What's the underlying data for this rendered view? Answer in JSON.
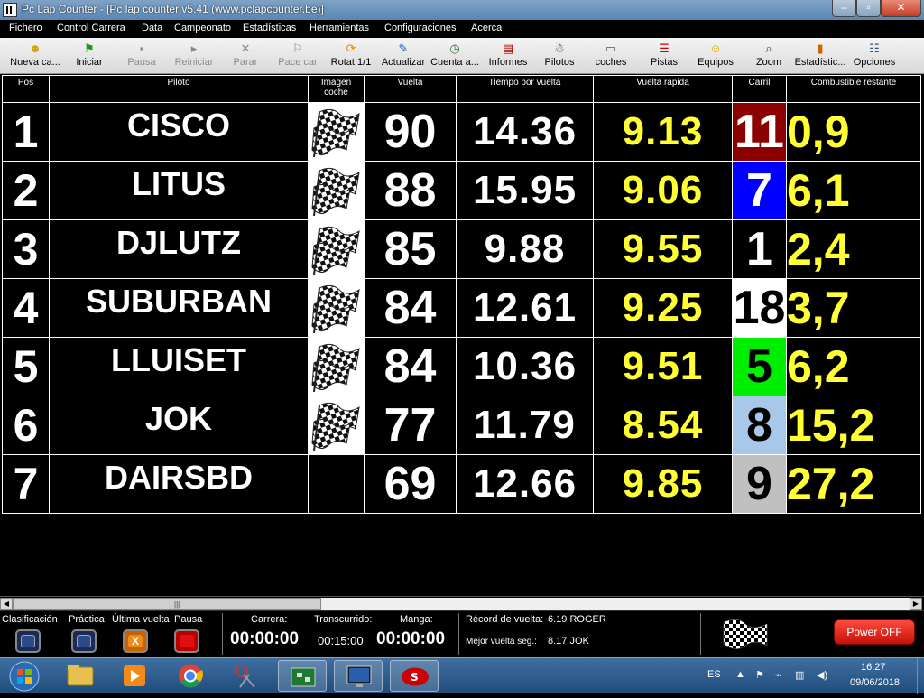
{
  "window": {
    "title": "Pc Lap Counter - [Pc lap counter v5.41 (www.pclapcounter.be)]"
  },
  "menu": [
    "Fichero",
    "Control Carrera",
    "Data",
    "Campeonato",
    "Estadísticas",
    "Herramientas",
    "Configuraciones",
    "Acerca"
  ],
  "toolbar": [
    {
      "label": "Nueva ca...",
      "icon": "new-race-icon",
      "enabled": true
    },
    {
      "label": "Iniciar",
      "icon": "start-flag-icon",
      "enabled": true
    },
    {
      "label": "Pausa",
      "icon": "pause-icon",
      "enabled": false
    },
    {
      "label": "Reiniciar",
      "icon": "restart-icon",
      "enabled": false
    },
    {
      "label": "Parar",
      "icon": "stop-x-icon",
      "enabled": false
    },
    {
      "label": "Pace car",
      "icon": "pace-car-flag-icon",
      "enabled": false
    },
    {
      "label": "Rotat 1/1",
      "icon": "rotate-icon",
      "enabled": true
    },
    {
      "label": "Actualizar",
      "icon": "refresh-icon",
      "enabled": true
    },
    {
      "label": "Cuenta a...",
      "icon": "countdown-clock-icon",
      "enabled": true
    },
    {
      "label": "Informes",
      "icon": "report-icon",
      "enabled": true
    },
    {
      "label": "Pilotos",
      "icon": "driver-helmet-icon",
      "enabled": true
    },
    {
      "label": "coches",
      "icon": "car-icon",
      "enabled": true
    },
    {
      "label": "Pistas",
      "icon": "track-icon",
      "enabled": true
    },
    {
      "label": "Equipos",
      "icon": "team-icon",
      "enabled": true
    },
    {
      "label": "Zoom",
      "icon": "zoom-icon",
      "enabled": true
    },
    {
      "label": "Estadístic...",
      "icon": "statistics-icon",
      "enabled": true
    },
    {
      "label": "Opciones",
      "icon": "options-icon",
      "enabled": true
    }
  ],
  "table": {
    "headers": [
      "Pos",
      "Piloto",
      "Imagen coche",
      "Vuelta",
      "Tiempo por vuelta",
      "Vuelta rápida",
      "Carril",
      "Combustible restante"
    ],
    "rows": [
      {
        "pos": "1",
        "pilot": "CISCO",
        "has_flag": true,
        "laps": "90",
        "lap_time": "14.36",
        "best_lap": "9.13",
        "lane": "11",
        "lane_bg": "#8b0000",
        "lane_fg": "#ffffff",
        "fuel": "0,9"
      },
      {
        "pos": "2",
        "pilot": "LITUS",
        "has_flag": true,
        "laps": "88",
        "lap_time": "15.95",
        "best_lap": "9.06",
        "lane": "7",
        "lane_bg": "#0000ff",
        "lane_fg": "#ffffff",
        "fuel": "6,1"
      },
      {
        "pos": "3",
        "pilot": "DJLUTZ",
        "has_flag": true,
        "laps": "85",
        "lap_time": "9.88",
        "best_lap": "9.55",
        "lane": "1",
        "lane_bg": "#000000",
        "lane_fg": "#ffffff",
        "fuel": "2,4"
      },
      {
        "pos": "4",
        "pilot": "SUBURBAN",
        "has_flag": true,
        "laps": "84",
        "lap_time": "12.61",
        "best_lap": "9.25",
        "lane": "18",
        "lane_bg": "#ffffff",
        "lane_fg": "#000000",
        "fuel": "3,7"
      },
      {
        "pos": "5",
        "pilot": "LLUISET",
        "has_flag": true,
        "laps": "84",
        "lap_time": "10.36",
        "best_lap": "9.51",
        "lane": "5",
        "lane_bg": "#00ee00",
        "lane_fg": "#000000",
        "fuel": "6,2"
      },
      {
        "pos": "6",
        "pilot": "JOK",
        "has_flag": true,
        "laps": "77",
        "lap_time": "11.79",
        "best_lap": "8.54",
        "lane": "8",
        "lane_bg": "#a8c8ea",
        "lane_fg": "#000000",
        "fuel": "15,2"
      },
      {
        "pos": "7",
        "pilot": "DAIRSBD",
        "has_flag": false,
        "laps": "69",
        "lap_time": "12.66",
        "best_lap": "9.85",
        "lane": "9",
        "lane_bg": "#c0c0c0",
        "lane_fg": "#000000",
        "fuel": "27,2"
      }
    ]
  },
  "status": {
    "clasificacion": "Clasificación",
    "practica": "Práctica",
    "ultima_vuelta": "Última vuelta",
    "pausa": "Pausa",
    "carrera_label": "Carrera:",
    "carrera_value": "00:00:00",
    "transcurrido_label": "Transcurrido:",
    "transcurrido_value": "00:15:00",
    "manga_label": "Manga:",
    "manga_value": "00:00:00",
    "record_label": "Récord de vuelta:",
    "record_value": "6.19 ROGER",
    "mejor_label": "Mejor vuelta seg.:",
    "mejor_value": "8.17 JOK",
    "power": "Power OFF"
  },
  "taskbar": {
    "lang": "ES",
    "time": "16:27",
    "date": "09/06/2018"
  }
}
